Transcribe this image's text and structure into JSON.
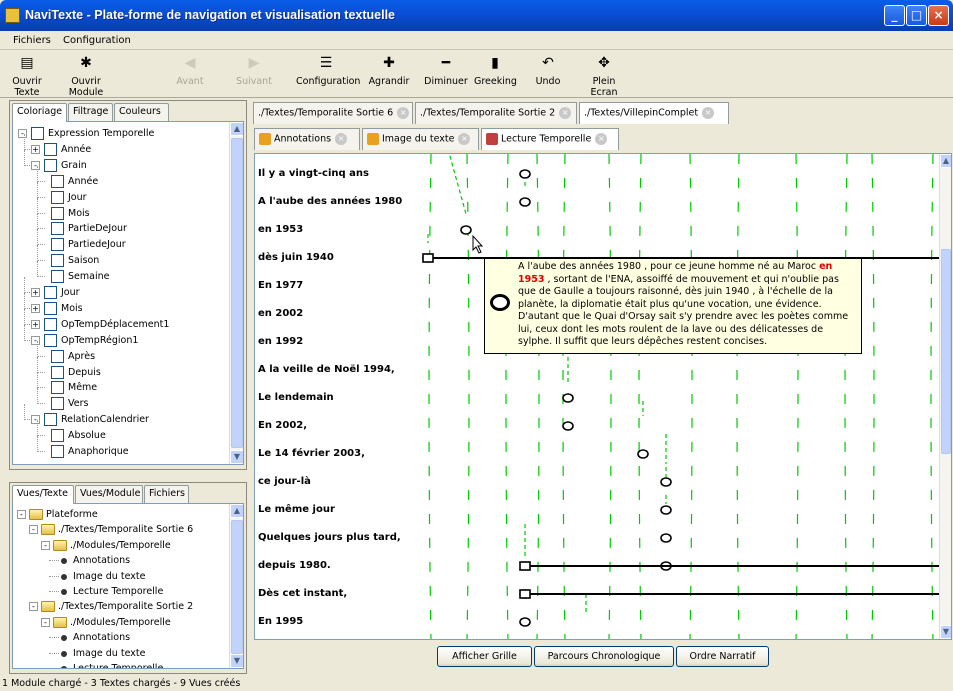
{
  "window": {
    "title": "NaviTexte - Plate-forme de navigation et visualisation textuelle"
  },
  "menu": [
    "Fichiers",
    "Configuration"
  ],
  "toolbar": [
    {
      "label": "Ouvrir Texte",
      "icon": "document-icon",
      "enabled": true
    },
    {
      "label": "Ouvrir Module",
      "icon": "module-icon",
      "enabled": true
    },
    {
      "label": "Avant",
      "icon": "back-icon",
      "enabled": false
    },
    {
      "label": "Suivant",
      "icon": "forward-icon",
      "enabled": false
    },
    {
      "label": "Configuration",
      "icon": "list-icon",
      "enabled": true
    },
    {
      "label": "Agrandir",
      "icon": "plus-icon",
      "enabled": true
    },
    {
      "label": "Diminuer",
      "icon": "minus-icon",
      "enabled": true
    },
    {
      "label": "Greeking",
      "icon": "greeking-icon",
      "enabled": true
    },
    {
      "label": "Undo",
      "icon": "undo-icon",
      "enabled": true
    },
    {
      "label": "Plein Ecran",
      "icon": "fullscreen-icon",
      "enabled": true
    }
  ],
  "top_panel": {
    "tabs": [
      "Coloriage",
      "Filtrage",
      "Couleurs"
    ],
    "active_tab": 0,
    "tree": [
      {
        "label": "Expression Temporelle",
        "level": 0,
        "expander": "-",
        "checkbox": true
      },
      {
        "label": "Année",
        "level": 1,
        "expander": "+",
        "checkbox": true
      },
      {
        "label": "Grain",
        "level": 1,
        "expander": "-",
        "checkbox": true
      },
      {
        "label": "Année",
        "level": 2,
        "expander": "",
        "checkbox": true
      },
      {
        "label": "Jour",
        "level": 2,
        "expander": "",
        "checkbox": true
      },
      {
        "label": "Mois",
        "level": 2,
        "expander": "",
        "checkbox": true
      },
      {
        "label": "PartieDeJour",
        "level": 2,
        "expander": "",
        "checkbox": true
      },
      {
        "label": "PartiedeJour",
        "level": 2,
        "expander": "",
        "checkbox": true
      },
      {
        "label": "Saison",
        "level": 2,
        "expander": "",
        "checkbox": true
      },
      {
        "label": "Semaine",
        "level": 2,
        "expander": "",
        "checkbox": true
      },
      {
        "label": "Jour",
        "level": 1,
        "expander": "+",
        "checkbox": true
      },
      {
        "label": "Mois",
        "level": 1,
        "expander": "+",
        "checkbox": true
      },
      {
        "label": "OpTempDéplacement1",
        "level": 1,
        "expander": "+",
        "checkbox": true
      },
      {
        "label": "OpTempRégion1",
        "level": 1,
        "expander": "-",
        "checkbox": true
      },
      {
        "label": "Après",
        "level": 2,
        "expander": "",
        "checkbox": true
      },
      {
        "label": "Depuis",
        "level": 2,
        "expander": "",
        "checkbox": true
      },
      {
        "label": "Même",
        "level": 2,
        "expander": "",
        "checkbox": true
      },
      {
        "label": "Vers",
        "level": 2,
        "expander": "",
        "checkbox": true
      },
      {
        "label": "RelationCalendrier",
        "level": 1,
        "expander": "-",
        "checkbox": true
      },
      {
        "label": "Absolue",
        "level": 2,
        "expander": "",
        "checkbox": true
      },
      {
        "label": "Anaphorique",
        "level": 2,
        "expander": "",
        "checkbox": true
      }
    ]
  },
  "bottom_panel": {
    "tabs": [
      "Vues/Texte",
      "Vues/Module",
      "Fichiers"
    ],
    "active_tab": 0,
    "tree": [
      {
        "label": "Plateforme",
        "level": 0,
        "kind": "folder"
      },
      {
        "label": "./Textes/Temporalite Sortie 6",
        "level": 1,
        "kind": "folder"
      },
      {
        "label": "./Modules/Temporelle",
        "level": 2,
        "kind": "folder"
      },
      {
        "label": "Annotations",
        "level": 3,
        "kind": "leaf"
      },
      {
        "label": "Image du texte",
        "level": 3,
        "kind": "leaf"
      },
      {
        "label": "Lecture Temporelle",
        "level": 3,
        "kind": "leaf"
      },
      {
        "label": "./Textes/Temporalite Sortie 2",
        "level": 1,
        "kind": "folder"
      },
      {
        "label": "./Modules/Temporelle",
        "level": 2,
        "kind": "folder"
      },
      {
        "label": "Annotations",
        "level": 3,
        "kind": "leaf"
      },
      {
        "label": "Image du texte",
        "level": 3,
        "kind": "leaf"
      },
      {
        "label": "Lecture Temporelle",
        "level": 3,
        "kind": "leaf"
      },
      {
        "label": "./Textes/VillepinComplet",
        "level": 1,
        "kind": "folder"
      }
    ]
  },
  "document_tabs": [
    "./Textes/Temporalite Sortie 6",
    "./Textes/Temporalite Sortie 2",
    "./Textes/VillepinComplet"
  ],
  "active_document_tab": 2,
  "view_tabs": [
    {
      "label": "Annotations",
      "icon": "annotations-icon"
    },
    {
      "label": "Image du texte",
      "icon": "image-icon"
    },
    {
      "label": "Lecture Temporelle",
      "icon": "calendar-icon"
    }
  ],
  "active_view_tab": 2,
  "visualization": {
    "rows": [
      "Il y a vingt-cinq ans",
      "A l'aube des années 1980",
      "en 1953",
      "dès juin 1940",
      "En 1977",
      "en 2002",
      "en 1992",
      "A la veille de Noël 1994,",
      "Le lendemain",
      "En 2002,",
      "Le 14 février 2003,",
      "ce jour-là",
      "Le même jour",
      "Quelques jours plus tard,",
      "depuis 1980.",
      "Dès cet instant,",
      "En 1995"
    ],
    "line_color": "#00c800",
    "tooltip": {
      "before": "A l'aube des années 1980 , pour ce jeune homme né au Maroc ",
      "highlight": "en 1953",
      "after": " , sortant de l'ENA, assoiffé de mouvement et qui n'oublie pas que de Gaulle a toujours raisonné, dès juin 1940 , à l'échelle de la planète, la diplomatie était plus qu'une vocation, une évidence. D'autant que le Quai d'Orsay sait s'y prendre avec les poètes comme lui, ceux dont les mots roulent de la lave ou des délicatesses de sylphe. Il suffit que leurs dépêches restent concises."
    }
  },
  "buttons": [
    "Afficher Grille",
    "Parcours Chronologique",
    "Ordre Narratif"
  ],
  "status": "1 Module chargé   -   3 Textes chargés   -   9 Vues créés"
}
